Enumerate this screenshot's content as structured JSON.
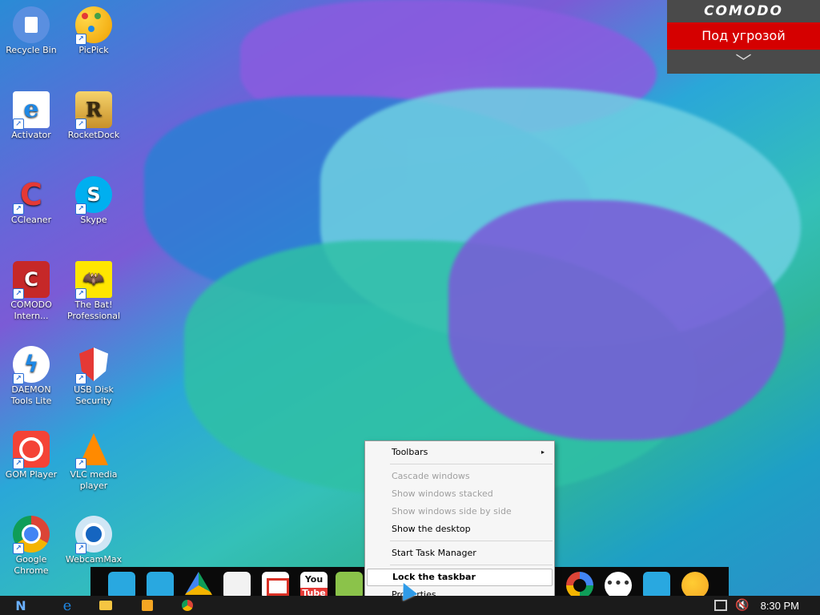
{
  "comodo_widget": {
    "brand": "COMODO",
    "status": "Под угрозой",
    "expand_icon": "chevron-down-icon",
    "status_color": "#d50000"
  },
  "desktop_icons": [
    {
      "label": "Recycle Bin",
      "icon": "recycle-bin-icon"
    },
    {
      "label": "PicPick",
      "icon": "picpick-icon"
    },
    {
      "label": "Activator",
      "icon": "internet-explorer-icon"
    },
    {
      "label": "RocketDock",
      "icon": "rocketdock-icon"
    },
    {
      "label": "CCleaner",
      "icon": "ccleaner-icon"
    },
    {
      "label": "Skype",
      "icon": "skype-icon"
    },
    {
      "label": "COMODO Intern...",
      "icon": "comodo-icon"
    },
    {
      "label": "The Bat! Professional",
      "icon": "the-bat-icon"
    },
    {
      "label": "DAEMON Tools Lite",
      "icon": "daemon-tools-icon"
    },
    {
      "label": "USB Disk Security",
      "icon": "usb-disk-security-icon"
    },
    {
      "label": "GOM Player",
      "icon": "gom-player-icon"
    },
    {
      "label": "VLC media player",
      "icon": "vlc-icon"
    },
    {
      "label": "Google Chrome",
      "icon": "chrome-icon"
    },
    {
      "label": "WebcamMax",
      "icon": "webcammax-icon"
    }
  ],
  "context_menu": {
    "items": [
      {
        "label": "Toolbars",
        "enabled": true,
        "submenu": true
      },
      {
        "label": "Cascade windows",
        "enabled": false
      },
      {
        "label": "Show windows stacked",
        "enabled": false
      },
      {
        "label": "Show windows side by side",
        "enabled": false
      },
      {
        "label": "Show the desktop",
        "enabled": true
      },
      {
        "label": "Start Task Manager",
        "enabled": true
      },
      {
        "label": "Lock the taskbar",
        "enabled": true,
        "highlighted": true
      },
      {
        "label": "Properties",
        "enabled": true
      }
    ],
    "submenu_arrow": "▸"
  },
  "dock_icons": [
    "folder-android-icon",
    "folder-icon",
    "google-drive-icon",
    "play-store-icon",
    "gmail-icon",
    "youtube-icon",
    "vine-icon",
    "picasa-icon",
    "ellipsis-icon",
    "folder-icon",
    "weather-icon"
  ],
  "taskbar": {
    "start_icon": "start-n-icon",
    "pinned": [
      "internet-explorer-icon",
      "file-explorer-icon",
      "media-player-icon",
      "chrome-icon"
    ],
    "tray_icons": [
      "network-icon",
      "volume-muted-icon"
    ],
    "clock": "8:30 PM"
  }
}
